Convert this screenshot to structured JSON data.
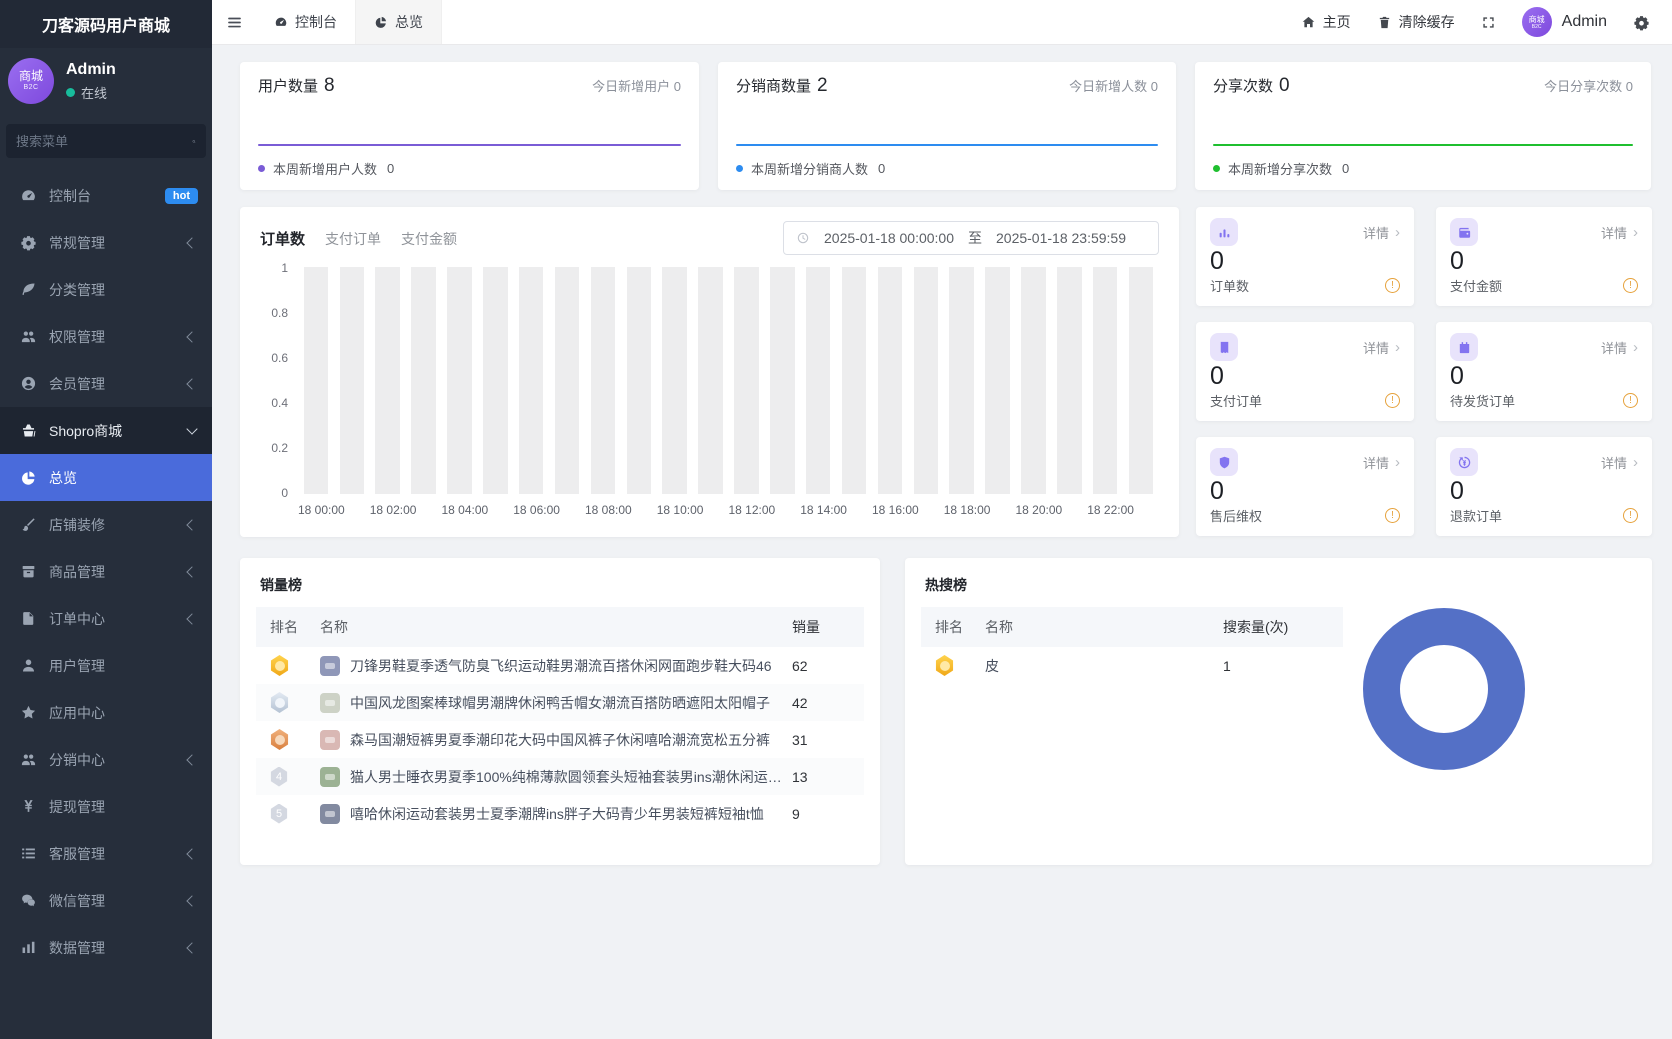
{
  "app": {
    "title": "刀客源码用户商城"
  },
  "sidebar": {
    "profile": {
      "name": "Admin",
      "status": "在线",
      "avatar_text": "商城",
      "avatar_sub": "B2C"
    },
    "search_placeholder": "搜索菜单",
    "menu": [
      {
        "id": "console",
        "label": "控制台",
        "icon": "dashboard-icon",
        "badge": "hot"
      },
      {
        "id": "general",
        "label": "常规管理",
        "icon": "cogs-icon",
        "chevron": true
      },
      {
        "id": "category",
        "label": "分类管理",
        "icon": "leaf-icon"
      },
      {
        "id": "permission",
        "label": "权限管理",
        "icon": "users-icon",
        "chevron": true
      },
      {
        "id": "member",
        "label": "会员管理",
        "icon": "member-icon",
        "chevron": true
      },
      {
        "id": "shopro",
        "label": "Shopro商城",
        "icon": "store-icon",
        "expanded": true
      },
      {
        "id": "overview",
        "label": "总览",
        "icon": "pie-icon",
        "active": true
      },
      {
        "id": "decoration",
        "label": "店铺装修",
        "icon": "brush-icon",
        "chevron": true
      },
      {
        "id": "goods",
        "label": "商品管理",
        "icon": "goods-icon",
        "chevron": true
      },
      {
        "id": "order-center",
        "label": "订单中心",
        "icon": "order-icon",
        "chevron": true
      },
      {
        "id": "user",
        "label": "用户管理",
        "icon": "user-icon"
      },
      {
        "id": "app-center",
        "label": "应用中心",
        "icon": "star-icon"
      },
      {
        "id": "distribution",
        "label": "分销中心",
        "icon": "team-icon",
        "chevron": true
      },
      {
        "id": "withdraw",
        "label": "提现管理",
        "icon": "yen-icon"
      },
      {
        "id": "service",
        "label": "客服管理",
        "icon": "service-icon",
        "chevron": true
      },
      {
        "id": "wechat",
        "label": "微信管理",
        "icon": "wechat-icon",
        "chevron": true
      },
      {
        "id": "data",
        "label": "数据管理",
        "icon": "data-icon",
        "chevron": true
      }
    ]
  },
  "header": {
    "tabs": [
      {
        "label": "控制台",
        "icon": "dashboard-icon"
      },
      {
        "label": "总览",
        "icon": "pie-icon",
        "active": true
      }
    ],
    "actions": {
      "home": "主页",
      "clear_cache": "清除缓存",
      "user": "Admin"
    }
  },
  "stat_cards": [
    {
      "title": "用户数量",
      "value": "8",
      "right_label": "今日新增用户 0",
      "legend": "本周新增用户人数",
      "legend_value": "0",
      "color": "#7a5cd6"
    },
    {
      "title": "分销商数量",
      "value": "2",
      "right_label": "今日新增人数 0",
      "legend": "本周新增分销商人数",
      "legend_value": "0",
      "color": "#2d8cf0"
    },
    {
      "title": "分享次数",
      "value": "0",
      "right_label": "今日分享次数 0",
      "legend": "本周新增分享次数",
      "legend_value": "0",
      "color": "#1fbf2f"
    }
  ],
  "order_panel": {
    "tabs": [
      "订单数",
      "支付订单",
      "支付金额"
    ],
    "active_tab": "订单数",
    "date_start": "2025-01-18 00:00:00",
    "date_sep": "至",
    "date_end": "2025-01-18 23:59:59"
  },
  "order_stats": {
    "detail_label": "详情",
    "cards": [
      {
        "id": "order-count",
        "label": "订单数",
        "value": "0",
        "icon": "kpi-bars-icon"
      },
      {
        "id": "pay-amount",
        "label": "支付金额",
        "value": "0",
        "icon": "kpi-wallet-icon"
      },
      {
        "id": "pay-order",
        "label": "支付订单",
        "value": "0",
        "icon": "kpi-receipt-icon"
      },
      {
        "id": "to-ship",
        "label": "待发货订单",
        "value": "0",
        "icon": "kpi-box-icon"
      },
      {
        "id": "aftersale",
        "label": "售后维权",
        "value": "0",
        "icon": "kpi-shield-icon"
      },
      {
        "id": "refund",
        "label": "退款订单",
        "value": "0",
        "icon": "kpi-refund-icon"
      }
    ]
  },
  "sales_rank": {
    "title": "销量榜",
    "headers": [
      "排名",
      "名称",
      "销量"
    ],
    "rows": [
      {
        "rank": 1,
        "name": "刀锋男鞋夏季透气防臭飞织运动鞋男潮流百搭休闲网面跑步鞋大码46",
        "value": "62",
        "thumb_color": "#8f97b8"
      },
      {
        "rank": 2,
        "name": "中国风龙图案棒球帽男潮牌休闲鸭舌帽女潮流百搭防晒遮阳太阳帽子",
        "value": "42",
        "thumb_color": "#cdd2c6"
      },
      {
        "rank": 3,
        "name": "森马国潮短裤男夏季潮印花大码中国风裤子休闲嘻哈潮流宽松五分裤",
        "value": "31",
        "thumb_color": "#d9b8b4"
      },
      {
        "rank": 4,
        "name": "猫人男士睡衣男夏季100%纯棉薄款圆领套头短袖套装男ins潮休闲运动...",
        "value": "13",
        "thumb_color": "#9cb294"
      },
      {
        "rank": 5,
        "name": "嘻哈休闲运动套装男士夏季潮牌ins胖子大码青少年男装短裤短袖t恤",
        "value": "9",
        "thumb_color": "#828aa0"
      }
    ]
  },
  "hot_search": {
    "title": "热搜榜",
    "headers": [
      "排名",
      "名称",
      "搜索量(次)"
    ],
    "rows": [
      {
        "rank": 1,
        "name": "皮",
        "value": "1"
      }
    ],
    "donut_color": "#5470c6"
  },
  "chart_data": [
    {
      "type": "bar",
      "title": "订单数(按小时)",
      "x": [
        "18 00:00",
        "18 01:00",
        "18 02:00",
        "18 03:00",
        "18 04:00",
        "18 05:00",
        "18 06:00",
        "18 07:00",
        "18 08:00",
        "18 09:00",
        "18 10:00",
        "18 11:00",
        "18 12:00",
        "18 13:00",
        "18 14:00",
        "18 15:00",
        "18 16:00",
        "18 17:00",
        "18 18:00",
        "18 19:00",
        "18 20:00",
        "18 21:00",
        "18 22:00",
        "18 23:00"
      ],
      "values": [
        0,
        0,
        0,
        0,
        0,
        0,
        0,
        0,
        0,
        0,
        0,
        0,
        0,
        0,
        0,
        0,
        0,
        0,
        0,
        0,
        0,
        0,
        0,
        0
      ],
      "x_tick_labels": [
        "18 00:00",
        "18 02:00",
        "18 04:00",
        "18 06:00",
        "18 08:00",
        "18 10:00",
        "18 12:00",
        "18 14:00",
        "18 16:00",
        "18 18:00",
        "18 20:00",
        "18 22:00"
      ],
      "ylim": [
        0,
        1
      ],
      "yticks": [
        0,
        0.2,
        0.4,
        0.6,
        0.8,
        1
      ],
      "note": "all values are zero; light gray full-height bars are background placeholders",
      "legend_position": "none"
    },
    {
      "type": "pie",
      "title": "热搜榜占比",
      "labels": [
        "皮"
      ],
      "values": [
        1
      ],
      "donut": true,
      "color": "#5470c6"
    },
    {
      "type": "line",
      "title": "本周新增(迷你图, 均为0)",
      "series": [
        {
          "name": "本周新增用户人数",
          "values": [
            0,
            0,
            0,
            0,
            0,
            0,
            0
          ],
          "color": "#7a5cd6"
        },
        {
          "name": "本周新增分销商人数",
          "values": [
            0,
            0,
            0,
            0,
            0,
            0,
            0
          ],
          "color": "#2d8cf0"
        },
        {
          "name": "本周新增分享次数",
          "values": [
            0,
            0,
            0,
            0,
            0,
            0,
            0
          ],
          "color": "#1fbf2f"
        }
      ]
    }
  ]
}
